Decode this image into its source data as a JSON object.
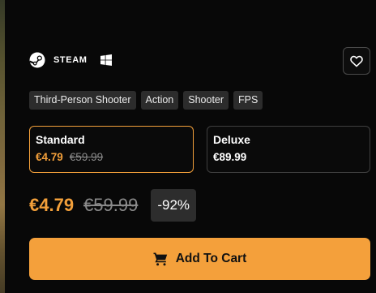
{
  "platforms": {
    "store_label": "STEAM",
    "store_icon": "steam-icon",
    "os_icon": "windows-icon"
  },
  "wishlist": {
    "icon": "heart-icon"
  },
  "tags": [
    "Third-Person Shooter",
    "Action",
    "Shooter",
    "FPS"
  ],
  "editions": [
    {
      "name": "Standard",
      "sale_price": "€4.79",
      "original_price": "€59.99",
      "selected": true
    },
    {
      "name": "Deluxe",
      "price": "€89.99",
      "selected": false
    }
  ],
  "pricing": {
    "current": "€4.79",
    "original": "€59.99",
    "discount": "-92%"
  },
  "cart": {
    "label": "Add To Cart",
    "icon": "cart-icon"
  },
  "colors": {
    "accent": "#f4a03b",
    "background": "#080808",
    "tag_bg": "#2c2c2c",
    "muted_text": "#8a8a8a"
  }
}
